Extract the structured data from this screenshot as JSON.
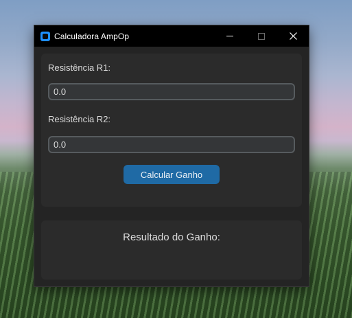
{
  "window": {
    "title": "Calculadora AmpOp",
    "controls": [
      "minimize",
      "maximize",
      "close"
    ]
  },
  "form": {
    "r1_label": "Resistência R1:",
    "r1_value": "0.0",
    "r2_label": "Resistência R2:",
    "r2_value": "0.0",
    "calculate_label": "Calcular Ganho"
  },
  "result": {
    "label": "Resultado do Ganho:"
  },
  "icons": {
    "app": "app-icon",
    "minimize": "minimize-icon",
    "maximize": "maximize-icon",
    "close": "close-icon"
  },
  "colors": {
    "accent": "#1f6aa5",
    "window_bg": "#242424",
    "frame_bg": "#2b2b2b",
    "titlebar_bg": "#000000"
  }
}
